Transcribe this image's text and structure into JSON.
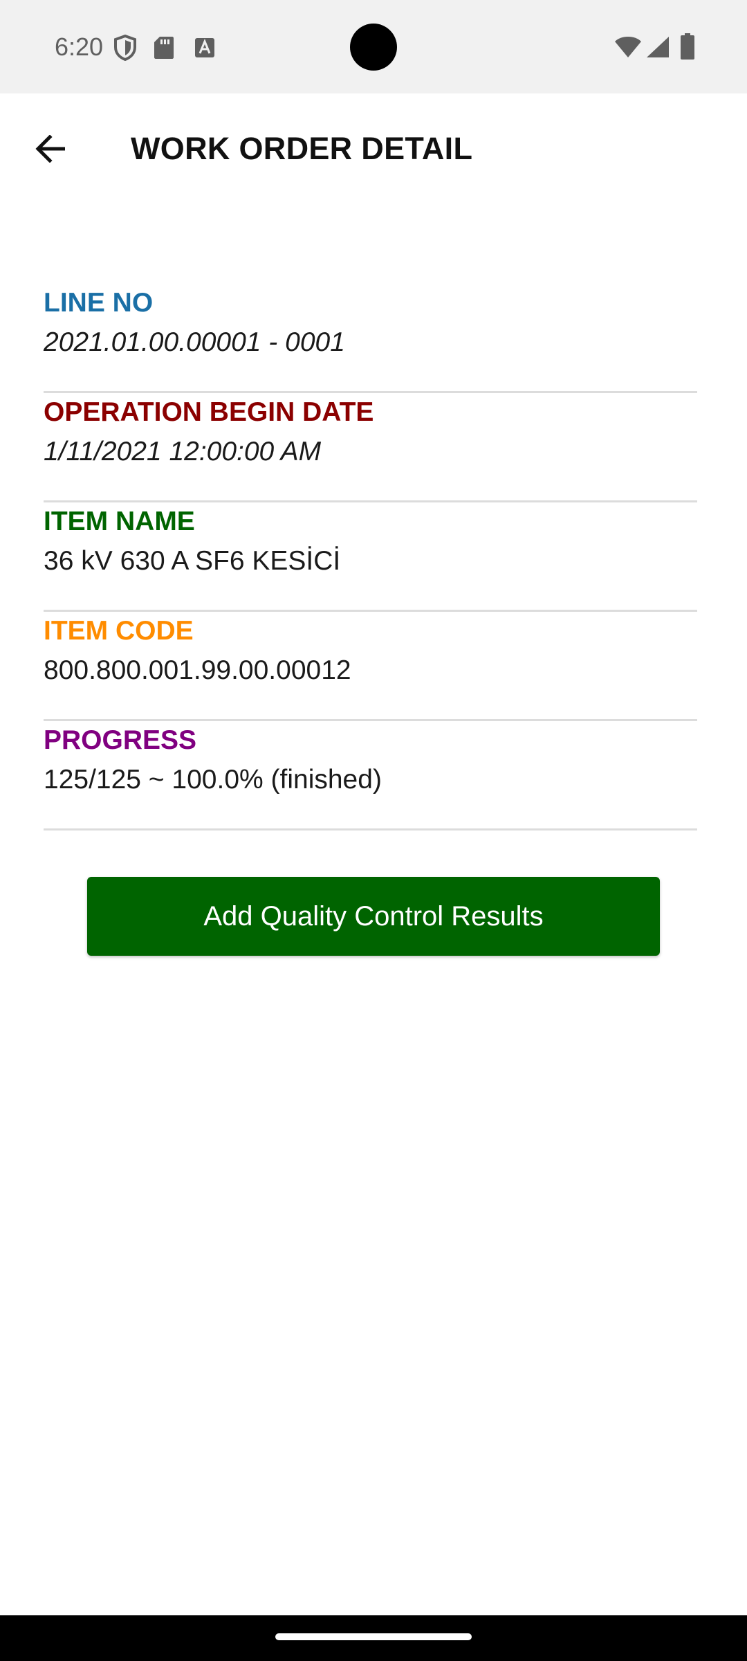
{
  "status_bar": {
    "time": "6:20",
    "left_icons": [
      "shield-icon",
      "sd-card-icon",
      "font-icon"
    ],
    "right_icons": [
      "wifi-icon",
      "signal-icon",
      "battery-icon"
    ]
  },
  "app_bar": {
    "title": "WORK ORDER DETAIL",
    "back_icon": "arrow-back-icon"
  },
  "details": [
    {
      "label": "LINE NO",
      "value": "2021.01.00.00001 - 0001",
      "label_color": "#1a6fa6",
      "italic": true
    },
    {
      "label": "OPERATION BEGIN DATE",
      "value": "1/11/2021 12:00:00 AM",
      "label_color": "#8b0000",
      "italic": true
    },
    {
      "label": "ITEM NAME",
      "value": "36 kV 630 A SF6 KESİCİ",
      "label_color": "#006400",
      "italic": false
    },
    {
      "label": "ITEM CODE",
      "value": "800.800.001.99.00.00012",
      "label_color": "#ff8c00",
      "italic": false
    },
    {
      "label": "PROGRESS",
      "value": "125/125 ~ 100.0% (finished)",
      "label_color": "#800080",
      "italic": false
    }
  ],
  "action_button": {
    "label": "Add Quality Control Results",
    "color": "#006400"
  }
}
